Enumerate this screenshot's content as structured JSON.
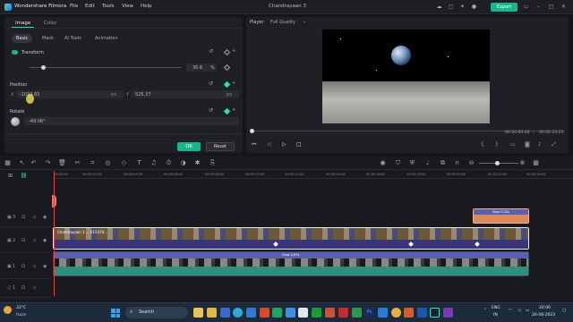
{
  "window": {
    "app_name": "Wondershare Filmora",
    "menu": [
      "File",
      "Edit",
      "Tools",
      "View",
      "Help"
    ],
    "project_title": "Chandrayaan 3",
    "export_label": "Export"
  },
  "left_panel": {
    "tabs": [
      "Image",
      "Color"
    ],
    "active_tab": "Image",
    "subtabs": [
      "Basic",
      "Mask",
      "AI Tools",
      "Animation"
    ],
    "active_subtab": "Basic",
    "transform_label": "Transform",
    "scale_value": "30.6",
    "scale_unit": "%",
    "position_label": "Position",
    "x_label": "X",
    "x_value": "-1033.65",
    "x_unit": "px",
    "y_label": "Y",
    "y_value": "525.37",
    "y_unit": "px",
    "rotate_label": "Rotate",
    "rotate_value": "-49.06°",
    "ok_label": "OK",
    "reset_label": "Reset"
  },
  "player": {
    "label": "Player",
    "quality": "Full Quality",
    "current_time": "00:00:00:00",
    "total_time": "00:00:23:21",
    "progress": 0
  },
  "timeline": {
    "ruler_ticks": [
      "00:00:00",
      "00:00:02:00",
      "00:00:04:00",
      "00:00:06:00",
      "00:00:08:00",
      "00:00:10:00",
      "00:00:12:00",
      "00:00:14:00",
      "00:00:16:00",
      "00:00:18:00",
      "00:00:20:00",
      "00:00:22:00",
      "00:00:24:00"
    ],
    "track_labels": [
      "3",
      "2",
      "1",
      "1"
    ],
    "clips": {
      "overlay_label": "Slow 0.50x",
      "main_clip_label": "Chandrayaan 3 ... 015474...",
      "lower_label": "Slow 0.63x"
    }
  },
  "taskbar": {
    "weather_temp": "33°C",
    "weather_desc": "Haze",
    "search_placeholder": "Search",
    "lang_line1": "ENG",
    "lang_line2": "IN",
    "time": "20:06",
    "date": "26-08-2023"
  },
  "colors": {
    "accent": "#17b58b",
    "clip_main": "#5b4ea0",
    "clip_overlay": "#d98a5a",
    "clip_lower": "#2f8f7a",
    "playhead": "#e04444"
  }
}
